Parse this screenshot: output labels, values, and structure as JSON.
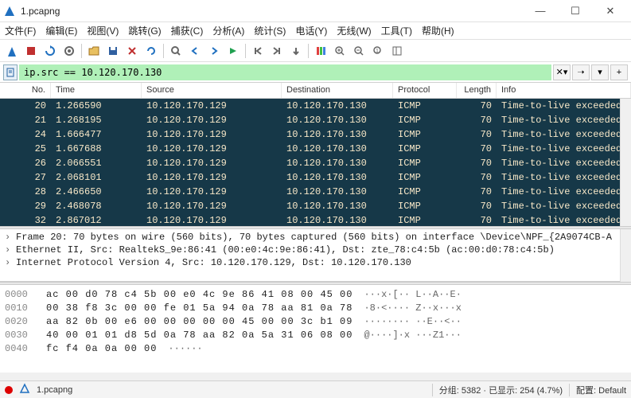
{
  "window": {
    "title": "1.pcapng"
  },
  "menus": [
    "文件(F)",
    "编辑(E)",
    "视图(V)",
    "跳转(G)",
    "捕获(C)",
    "分析(A)",
    "统计(S)",
    "电话(Y)",
    "无线(W)",
    "工具(T)",
    "帮助(H)"
  ],
  "filter": {
    "value": "ip.src == 10.120.170.130"
  },
  "columns": {
    "no": "No.",
    "time": "Time",
    "src": "Source",
    "dst": "Destination",
    "proto": "Protocol",
    "len": "Length",
    "info": "Info"
  },
  "packets": [
    {
      "no": 20,
      "time": "1.266590",
      "src": "10.120.170.129",
      "dst": "10.120.170.130",
      "proto": "ICMP",
      "len": 70,
      "info": "Time-to-live exceeded (T"
    },
    {
      "no": 21,
      "time": "1.268195",
      "src": "10.120.170.129",
      "dst": "10.120.170.130",
      "proto": "ICMP",
      "len": 70,
      "info": "Time-to-live exceeded (T"
    },
    {
      "no": 24,
      "time": "1.666477",
      "src": "10.120.170.129",
      "dst": "10.120.170.130",
      "proto": "ICMP",
      "len": 70,
      "info": "Time-to-live exceeded (T"
    },
    {
      "no": 25,
      "time": "1.667688",
      "src": "10.120.170.129",
      "dst": "10.120.170.130",
      "proto": "ICMP",
      "len": 70,
      "info": "Time-to-live exceeded (T"
    },
    {
      "no": 26,
      "time": "2.066551",
      "src": "10.120.170.129",
      "dst": "10.120.170.130",
      "proto": "ICMP",
      "len": 70,
      "info": "Time-to-live exceeded (T"
    },
    {
      "no": 27,
      "time": "2.068101",
      "src": "10.120.170.129",
      "dst": "10.120.170.130",
      "proto": "ICMP",
      "len": 70,
      "info": "Time-to-live exceeded (T"
    },
    {
      "no": 28,
      "time": "2.466650",
      "src": "10.120.170.129",
      "dst": "10.120.170.130",
      "proto": "ICMP",
      "len": 70,
      "info": "Time-to-live exceeded (T"
    },
    {
      "no": 29,
      "time": "2.468078",
      "src": "10.120.170.129",
      "dst": "10.120.170.130",
      "proto": "ICMP",
      "len": 70,
      "info": "Time-to-live exceeded (T"
    },
    {
      "no": 32,
      "time": "2.867012",
      "src": "10.120.170.129",
      "dst": "10.120.170.130",
      "proto": "ICMP",
      "len": 70,
      "info": "Time-to-live exceeded (T"
    }
  ],
  "details": [
    "Frame 20: 70 bytes on wire (560 bits), 70 bytes captured (560 bits) on interface \\Device\\NPF_{2A9074CB-A",
    "Ethernet II, Src: RealtekS_9e:86:41 (00:e0:4c:9e:86:41), Dst: zte_78:c4:5b (ac:00:d0:78:c4:5b)",
    "Internet Protocol Version 4, Src: 10.120.170.129, Dst: 10.120.170.130"
  ],
  "hex": [
    {
      "off": "0000",
      "b": "ac 00 d0 78 c4 5b 00 e0  4c 9e 86 41 08 00 45 00",
      "a": "···x·[·· L··A··E·"
    },
    {
      "off": "0010",
      "b": "00 38 f8 3c 00 00 fe 01  5a 94 0a 78 aa 81 0a 78",
      "a": "·8·<···· Z··x···x"
    },
    {
      "off": "0020",
      "b": "aa 82 0b 00 e6 00 00 00  00 00 45 00 00 3c b1 09",
      "a": "········ ··E··<··"
    },
    {
      "off": "0030",
      "b": "40 00 01 01 d8 5d 0a 78  aa 82 0a 5a 31 06 08 00",
      "a": "@····]·x ···Z1···"
    },
    {
      "off": "0040",
      "b": "fc f4 0a 0a 00 00",
      "a": "······"
    }
  ],
  "status": {
    "file": "1.pcapng",
    "pkts": "分组: 5382 · 已显示: 254 (4.7%)",
    "profile": "配置: Default"
  }
}
